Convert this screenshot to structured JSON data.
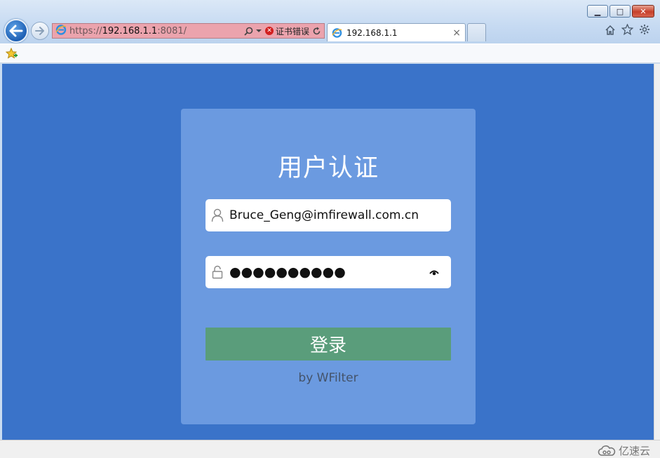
{
  "browser": {
    "address": {
      "scheme": "https://",
      "host": "192.168.1.1",
      "port": ":8081/"
    },
    "cert_error_label": "证书错误",
    "tab": {
      "title": "192.168.1.1",
      "close": "×"
    },
    "window": {
      "minimize": "▁",
      "restore": "□",
      "close": "✕"
    }
  },
  "login": {
    "title": "用户认证",
    "username_value": "Bruce_Geng@imfirewall.com.cn",
    "password_masked": "●●●●●●●●●●",
    "submit_label": "登录",
    "by_line": "by WFilter"
  },
  "watermark": {
    "text": "亿速云"
  },
  "colors": {
    "page_bg": "#3a73c9",
    "card_bg": "#6b9ae0",
    "button_bg": "#5a9d7b",
    "address_error_bg": "#eba3ad"
  }
}
